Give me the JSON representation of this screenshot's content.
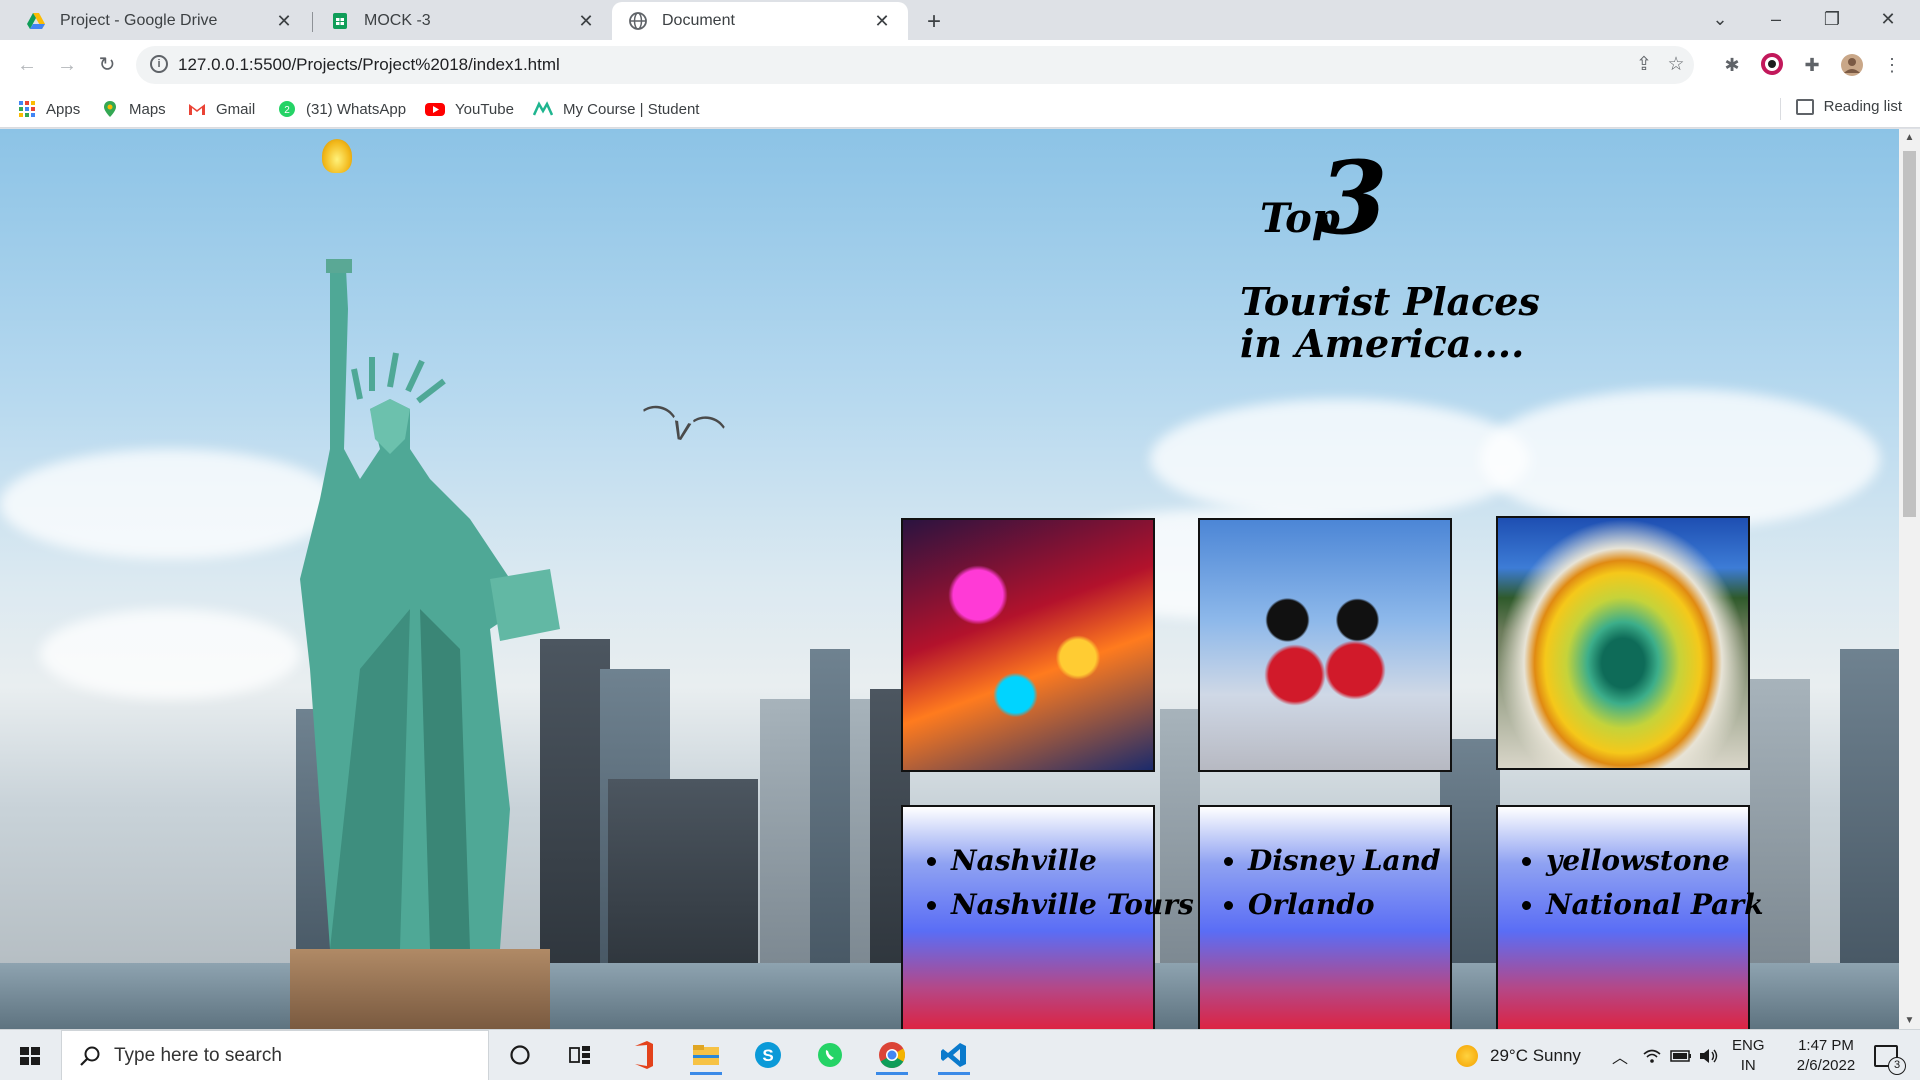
{
  "browser": {
    "tabs": [
      {
        "title": "Project - Google Drive",
        "close": "✕",
        "active": false
      },
      {
        "title": "MOCK -3",
        "close": "✕",
        "active": false
      },
      {
        "title": "Document",
        "close": "✕",
        "active": true
      }
    ],
    "new_tab": "+",
    "window_controls": {
      "tab_search": "⌄",
      "minimize": "–",
      "maximize": "❐",
      "close": "✕"
    },
    "url": "127.0.0.1:5500/Projects/Project%2018/index1.html",
    "bookmarks": [
      {
        "label": "Apps",
        "icon": "apps-grid-icon"
      },
      {
        "label": "Maps",
        "icon": "maps-pin-icon"
      },
      {
        "label": "Gmail",
        "icon": "gmail-icon"
      },
      {
        "label": "(31) WhatsApp",
        "icon": "whatsapp-icon"
      },
      {
        "label": "YouTube",
        "icon": "youtube-icon"
      },
      {
        "label": "My Course | Student",
        "icon": "course-icon"
      }
    ],
    "reading_list": "Reading list"
  },
  "page": {
    "headline": {
      "top": "Top",
      "number": "3",
      "subtitle": "Tourist Places in America...."
    },
    "cards": [
      {
        "items": [
          "Nashville",
          "Nashville Tours"
        ]
      },
      {
        "items": [
          "Disney Land",
          "Orlando"
        ]
      },
      {
        "items": [
          "yellowstone",
          "National Park"
        ]
      }
    ]
  },
  "taskbar": {
    "search_placeholder": "Type here to search",
    "weather": "29°C  Sunny",
    "lang_line1": "ENG",
    "lang_line2": "IN",
    "time": "1:47 PM",
    "date": "2/6/2022",
    "notifications": "3"
  },
  "colors": {
    "accent": "#3a8ae8",
    "card_top": "#ffffff",
    "card_mid": "#5a6df5",
    "card_bottom": "#e0203c"
  }
}
